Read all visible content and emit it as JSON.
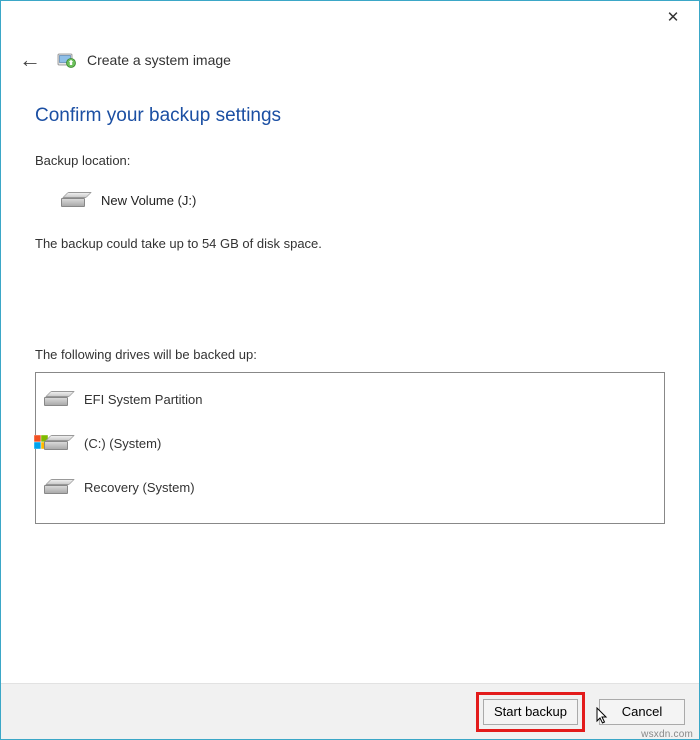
{
  "window": {
    "wizard_title": "Create a system image"
  },
  "heading": "Confirm your backup settings",
  "backup_location_label": "Backup location:",
  "backup_location_value": "New Volume (J:)",
  "space_estimate": "The backup could take up to 54 GB of disk space.",
  "drives_label": "The following drives will be backed up:",
  "drives": [
    {
      "name": "EFI System Partition",
      "has_windows_badge": false
    },
    {
      "name": "(C:) (System)",
      "has_windows_badge": true
    },
    {
      "name": "Recovery (System)",
      "has_windows_badge": false
    }
  ],
  "buttons": {
    "start": "Start backup",
    "cancel": "Cancel"
  },
  "attribution": "wsxdn.com"
}
